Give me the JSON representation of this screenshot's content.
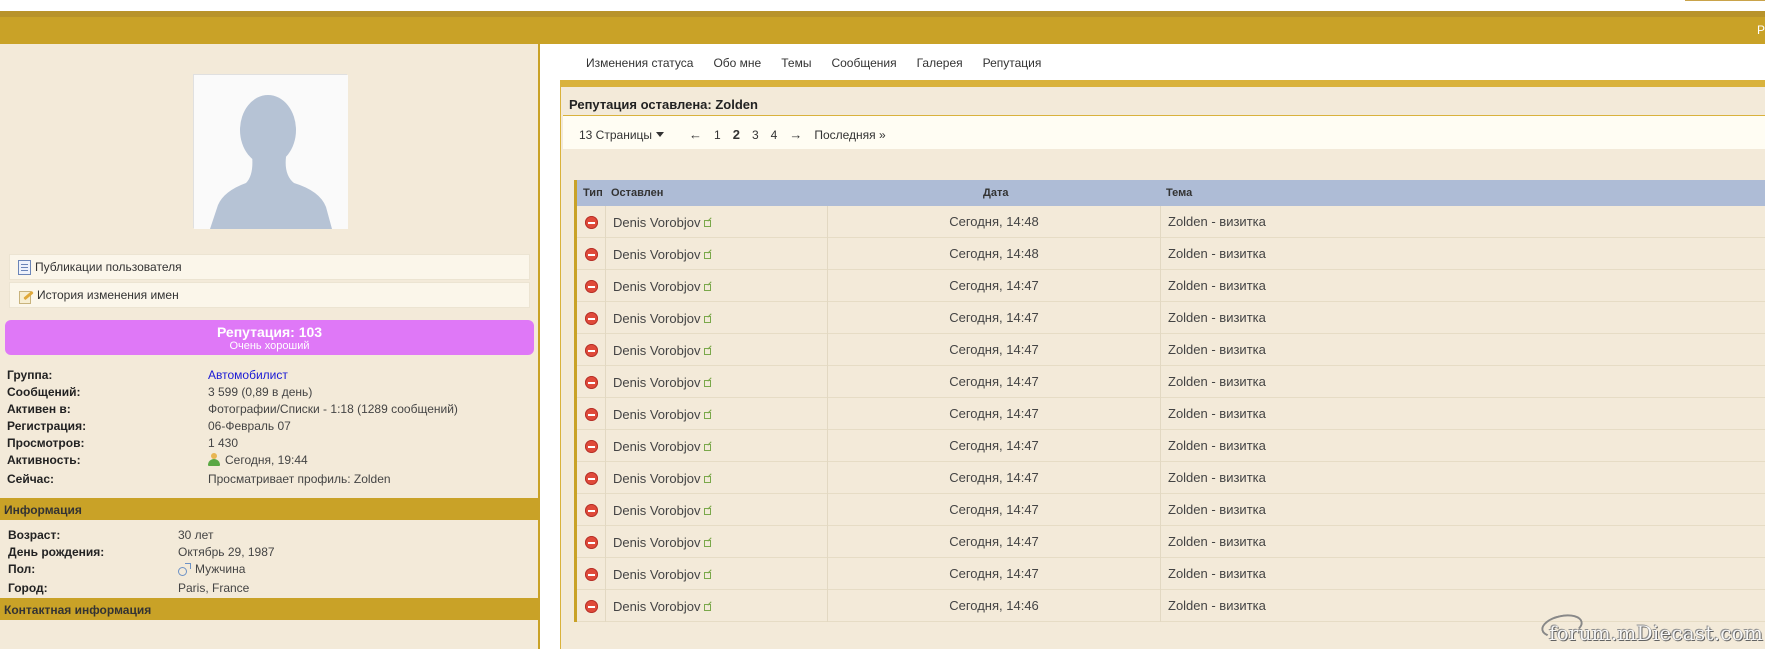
{
  "topbar": {
    "right_text": "P"
  },
  "profile": {
    "links": [
      {
        "label": "Публикации пользователя",
        "icon": "document-icon"
      },
      {
        "label": "История изменения имен",
        "icon": "edit-names-icon"
      }
    ],
    "reputation": {
      "title": "Репутация: 103",
      "subtitle": "Очень хороший",
      "color": "#df78f7"
    },
    "details": [
      {
        "key": "Группа:",
        "value": "Автомобилист"
      },
      {
        "key": "Сообщений:",
        "value": "3 599 (0,89 в день)"
      },
      {
        "key": "Активен в:",
        "value": "Фотографии/Списки - 1:18 (1289 сообщений)"
      },
      {
        "key": "Регистрация:",
        "value": "06-Февраль 07"
      },
      {
        "key": "Просмотров:",
        "value": "1 430"
      },
      {
        "key": "Активность:",
        "value": "Сегодня, 19:44"
      },
      {
        "key": "Сейчас:",
        "value": "Просматривает профиль: Zolden"
      }
    ],
    "info_section": "Информация",
    "info": [
      {
        "key": "Возраст:",
        "value": "30 лет"
      },
      {
        "key": "День рождения:",
        "value": "Октябрь 29, 1987"
      },
      {
        "key": "Пол:",
        "value": "Мужчина"
      },
      {
        "key": "Город:",
        "value": "Paris, France"
      }
    ],
    "contact_section": "Контактная информация"
  },
  "tabs": [
    "Изменения статуса",
    "Обо мне",
    "Темы",
    "Сообщения",
    "Галерея",
    "Репутация"
  ],
  "panel": {
    "title": "Репутация оставлена: Zolden",
    "pager": {
      "pages_label": "13 Страницы",
      "prev": "←",
      "pages": [
        "1",
        "2",
        "3",
        "4"
      ],
      "current": "2",
      "next": "→",
      "last": "Последняя »"
    },
    "columns": {
      "type": "Тип",
      "who": "Оставлен",
      "date": "Дата",
      "topic": "Тема"
    },
    "rows": [
      {
        "who": "Denis Vorobjov",
        "date": "Сегодня, 14:48",
        "topic": "Zolden - визитка"
      },
      {
        "who": "Denis Vorobjov",
        "date": "Сегодня, 14:48",
        "topic": "Zolden - визитка"
      },
      {
        "who": "Denis Vorobjov",
        "date": "Сегодня, 14:47",
        "topic": "Zolden - визитка"
      },
      {
        "who": "Denis Vorobjov",
        "date": "Сегодня, 14:47",
        "topic": "Zolden - визитка"
      },
      {
        "who": "Denis Vorobjov",
        "date": "Сегодня, 14:47",
        "topic": "Zolden - визитка"
      },
      {
        "who": "Denis Vorobjov",
        "date": "Сегодня, 14:47",
        "topic": "Zolden - визитка"
      },
      {
        "who": "Denis Vorobjov",
        "date": "Сегодня, 14:47",
        "topic": "Zolden - визитка"
      },
      {
        "who": "Denis Vorobjov",
        "date": "Сегодня, 14:47",
        "topic": "Zolden - визитка"
      },
      {
        "who": "Denis Vorobjov",
        "date": "Сегодня, 14:47",
        "topic": "Zolden - визитка"
      },
      {
        "who": "Denis Vorobjov",
        "date": "Сегодня, 14:47",
        "topic": "Zolden - визитка"
      },
      {
        "who": "Denis Vorobjov",
        "date": "Сегодня, 14:47",
        "topic": "Zolden - визитка"
      },
      {
        "who": "Denis Vorobjov",
        "date": "Сегодня, 14:47",
        "topic": "Zolden - визитка"
      },
      {
        "who": "Denis Vorobjov",
        "date": "Сегодня, 14:46",
        "topic": "Zolden - визитка"
      }
    ]
  },
  "watermark": "forum.mDiecast.com"
}
